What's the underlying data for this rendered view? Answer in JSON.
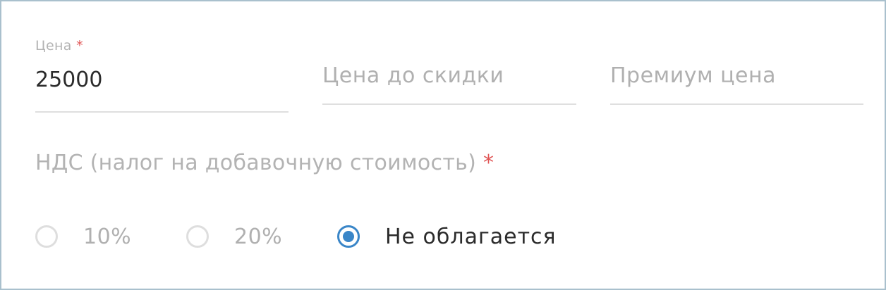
{
  "price_field": {
    "label": "Цена",
    "required_mark": "*",
    "value": "25000"
  },
  "price_before_discount_field": {
    "placeholder": "Цена до скидки",
    "value": ""
  },
  "premium_price_field": {
    "placeholder": "Премиум цена",
    "value": ""
  },
  "vat": {
    "label": "НДС (налог на добавочную стоимость)",
    "required_mark": "*",
    "options": [
      {
        "label": "10%",
        "selected": false
      },
      {
        "label": "20%",
        "selected": false
      },
      {
        "label": "Не облагается",
        "selected": true
      }
    ]
  },
  "colors": {
    "accent": "#3a86c8",
    "required": "#e05555",
    "border": "#a9c0cd"
  }
}
